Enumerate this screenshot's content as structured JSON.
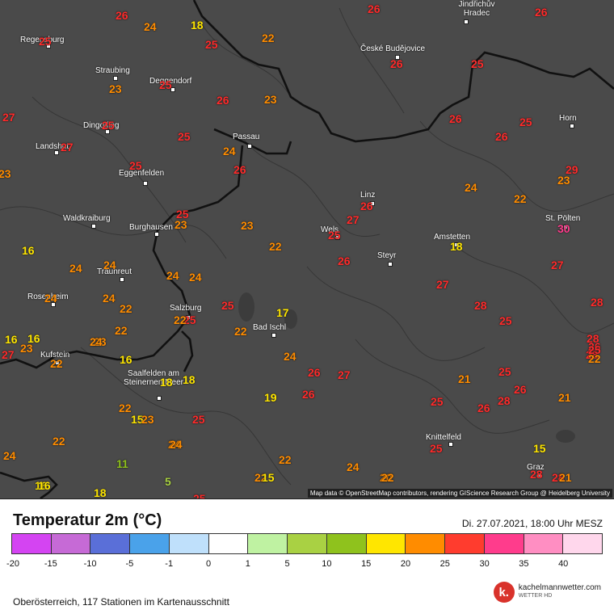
{
  "map": {
    "attribution": "Map data © OpenStreetMap contributors, rendering GIScience Research Group @ Heidelberg University",
    "cities": [
      {
        "name": "Regensburg"
      },
      {
        "name": "Straubing"
      },
      {
        "name": "Deggendorf"
      },
      {
        "name": "Dingolfing"
      },
      {
        "name": "Landshut"
      },
      {
        "name": "Passau"
      },
      {
        "name": "Eggenfelden"
      },
      {
        "name": "Waldkraiburg"
      },
      {
        "name": "Burghausen"
      },
      {
        "name": "Traunreut"
      },
      {
        "name": "Rosenheim"
      },
      {
        "name": "Salzburg"
      },
      {
        "name": "Bad Ischl"
      },
      {
        "name": "Kufstein"
      },
      {
        "name": "Saalfelden am Steinernen Meer"
      },
      {
        "name": "Jindřichův Hradec"
      },
      {
        "name": "České Budějovice"
      },
      {
        "name": "Horn"
      },
      {
        "name": "Linz"
      },
      {
        "name": "Wels"
      },
      {
        "name": "Steyr"
      },
      {
        "name": "Amstetten"
      },
      {
        "name": "St. Pölten"
      },
      {
        "name": "Knittelfeld"
      },
      {
        "name": "Graz"
      }
    ],
    "temperatures": [
      "26",
      "26",
      "26",
      "24",
      "18",
      "25",
      "22",
      "25",
      "27",
      "26",
      "25",
      "23",
      "25",
      "26",
      "23",
      "23",
      "25",
      "27",
      "25",
      "25",
      "29",
      "24",
      "26",
      "26",
      "25",
      "30",
      "22",
      "24",
      "26",
      "23",
      "26",
      "25",
      "23",
      "23",
      "22",
      "16",
      "24",
      "24",
      "24",
      "24",
      "27",
      "28",
      "24",
      "22",
      "25",
      "27",
      "25",
      "16",
      "16",
      "23",
      "22",
      "17",
      "22",
      "26",
      "18",
      "24",
      "27",
      "22",
      "19",
      "22",
      "24",
      "28",
      "28",
      "26",
      "15",
      "23",
      "22",
      "25",
      "25",
      "26",
      "27",
      "21",
      "24",
      "24",
      "26",
      "21",
      "25",
      "28",
      "22",
      "25",
      "26",
      "28",
      "25",
      "24",
      "16",
      "18",
      "24",
      "11",
      "22",
      "16",
      "18",
      "5",
      "15",
      "20",
      "22",
      "15",
      "28",
      "28",
      "26",
      "27",
      "25",
      "22",
      "21",
      "25",
      "22",
      "24",
      "16",
      "23",
      "25",
      "18"
    ]
  },
  "legend": {
    "title": "Temperatur 2m (°C)",
    "date": "Di. 27.07.2021, 18:00 Uhr MESZ",
    "colors": [
      "#d444f2",
      "#c66ad6",
      "#5a6fd8",
      "#4aa2ea",
      "#bfe0fb",
      "#ffffff",
      "#bff2a2",
      "#a9d143",
      "#8fc21d",
      "#ffe600",
      "#ff8c00",
      "#ff3c2e",
      "#ff3c8c",
      "#ff8ec2",
      "#ffd7ec"
    ],
    "ticks": [
      "-20",
      "-15",
      "-10",
      "-5",
      "-1",
      "0",
      "1",
      "5",
      "10",
      "15",
      "20",
      "25",
      "30",
      "35",
      "40"
    ]
  },
  "footer": {
    "stations_text": "Oberösterreich, 117 Stationen im Kartenausschnitt"
  },
  "brand": {
    "logo": "k.",
    "name": "kachelmannwetter.com",
    "sub": "WETTER HD"
  }
}
